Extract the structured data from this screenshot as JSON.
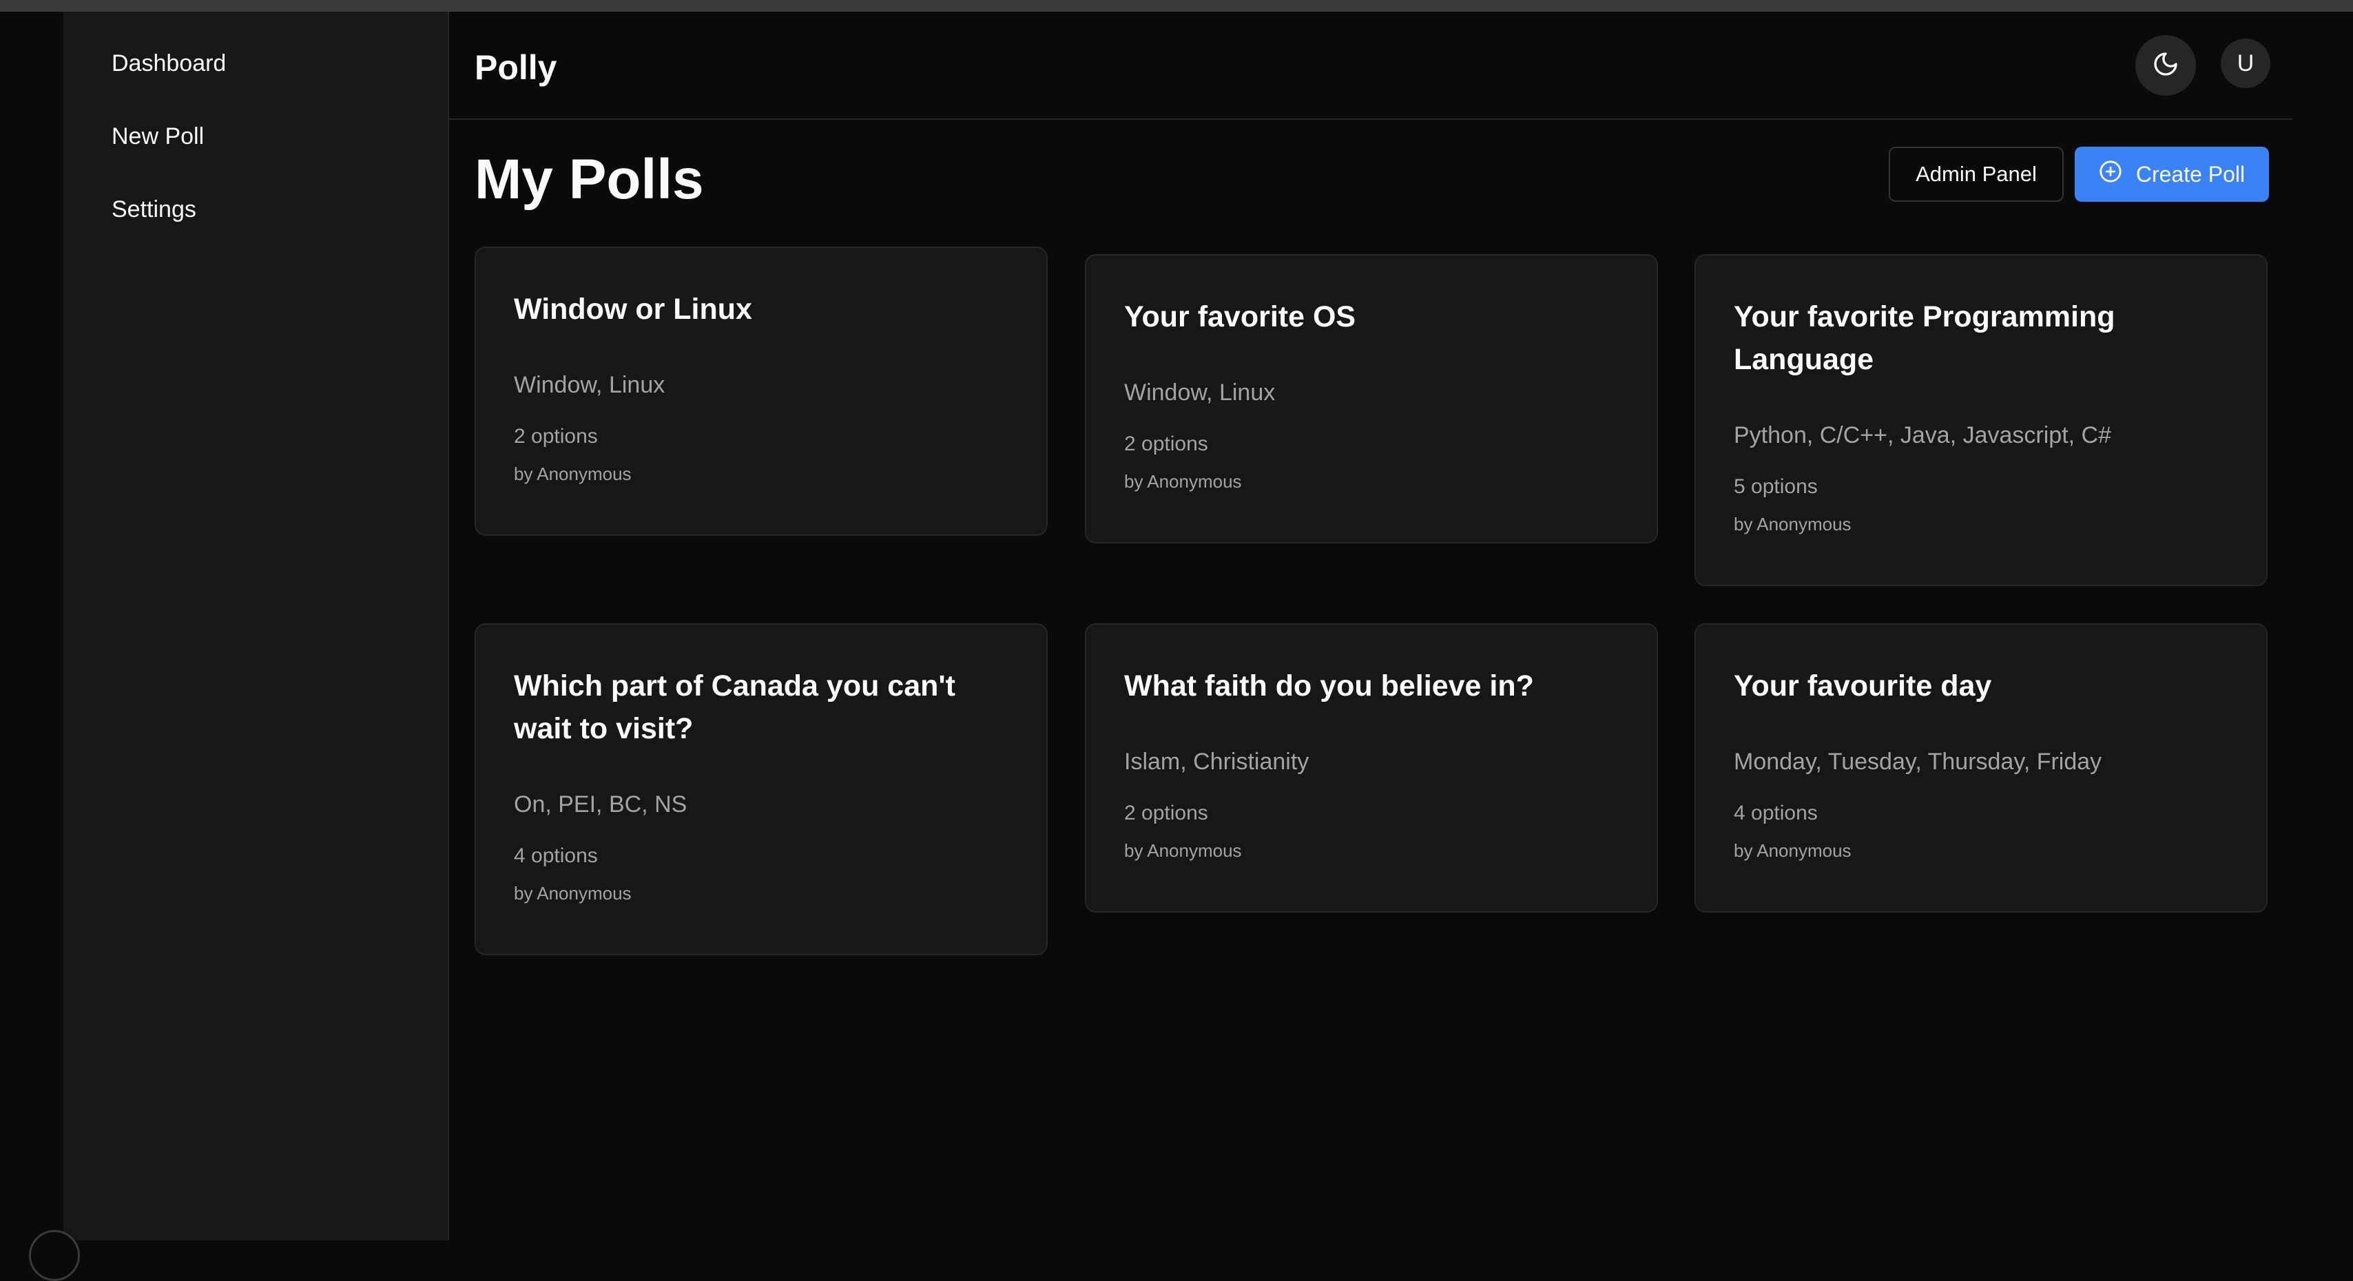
{
  "app": {
    "brand": "Polly"
  },
  "sidebar": {
    "items": [
      {
        "label": "Dashboard"
      },
      {
        "label": "New Poll"
      },
      {
        "label": "Settings"
      }
    ]
  },
  "header": {
    "avatar_initial": "U",
    "theme_icon": "moon-icon"
  },
  "main": {
    "title": "My Polls",
    "admin_button": "Admin Panel",
    "create_button": "Create Poll",
    "create_icon": "plus-circle-icon"
  },
  "polls": [
    {
      "question": "Window or Linux",
      "options": "Window, Linux",
      "count": "2 options",
      "author": "by Anonymous"
    },
    {
      "question": "Your favorite OS",
      "options": "Window, Linux",
      "count": "2 options",
      "author": "by Anonymous"
    },
    {
      "question": "Your favorite Programming Language",
      "options": "Python, C/C++, Java, Javascript, C#",
      "count": "5 options",
      "author": "by Anonymous"
    },
    {
      "question": "Which part of Canada you can't wait to visit?",
      "options": "On, PEI, BC, NS",
      "count": "4 options",
      "author": "by Anonymous"
    },
    {
      "question": "What faith do you believe in?",
      "options": "Islam, Christianity",
      "count": "2 options",
      "author": "by Anonymous"
    },
    {
      "question": "Your favourite day",
      "options": "Monday, Tuesday, Thursday, Friday",
      "count": "4 options",
      "author": "by Anonymous"
    }
  ],
  "colors": {
    "accent": "#3b82f6",
    "background": "#0a0a0a",
    "card": "#171717",
    "muted_text": "#a3a3a3"
  }
}
